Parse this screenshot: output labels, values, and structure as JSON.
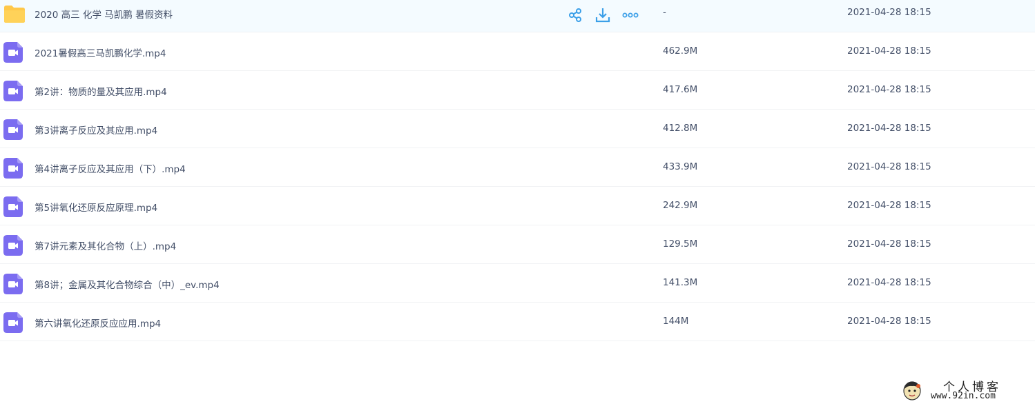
{
  "files": [
    {
      "name": "2020 高三 化学 马凯鹏 暑假资料",
      "size": "-",
      "modified": "2021-04-28 18:15",
      "type": "folder-icon"
    },
    {
      "name": "2021暑假高三马凯鹏化学.mp4",
      "size": "462.9M",
      "modified": "2021-04-28 18:15",
      "type": "video-file-icon"
    },
    {
      "name": "第2讲：物质的量及其应用.mp4",
      "size": "417.6M",
      "modified": "2021-04-28 18:15",
      "type": "video-file-icon"
    },
    {
      "name": "第3讲离子反应及其应用.mp4",
      "size": "412.8M",
      "modified": "2021-04-28 18:15",
      "type": "video-file-icon"
    },
    {
      "name": "第4讲离子反应及其应用（下）.mp4",
      "size": "433.9M",
      "modified": "2021-04-28 18:15",
      "type": "video-file-icon"
    },
    {
      "name": "第5讲氧化还原反应原理.mp4",
      "size": "242.9M",
      "modified": "2021-04-28 18:15",
      "type": "video-file-icon"
    },
    {
      "name": "第7讲元素及其化合物（上）.mp4",
      "size": "129.5M",
      "modified": "2021-04-28 18:15",
      "type": "video-file-icon"
    },
    {
      "name": "第8讲；金属及其化合物综合（中）_ev.mp4",
      "size": "141.3M",
      "modified": "2021-04-28 18:15",
      "type": "video-file-icon"
    },
    {
      "name": "第六讲氧化还原反应应用.mp4",
      "size": "144M",
      "modified": "2021-04-28 18:15",
      "type": "video-file-icon"
    }
  ],
  "row_actions": {
    "share_icon": "share-icon",
    "download_icon": "download-icon",
    "more_icon": "more-icon"
  },
  "watermark": {
    "title": "个人博客",
    "url": "www.92in.com"
  },
  "colors": {
    "accent": "#3b9fe8",
    "video_icon": "#7b6cf0",
    "folder_icon": "#ffc84a",
    "hover_row": "#f4fbff",
    "text": "#424e67"
  }
}
